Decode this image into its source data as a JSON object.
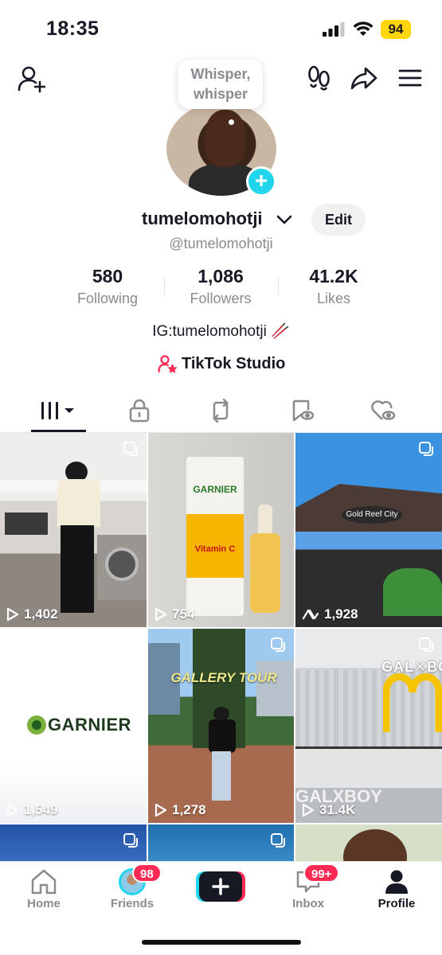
{
  "status_bar": {
    "time": "18:35",
    "battery": "94"
  },
  "profile": {
    "tooltip": "Whisper, whisper",
    "username": "tumelomohotji",
    "handle": "@tumelomohotji",
    "edit_label": "Edit",
    "stats": [
      {
        "value": "580",
        "label": "Following"
      },
      {
        "value": "1,086",
        "label": "Followers"
      },
      {
        "value": "41.2K",
        "label": "Likes"
      }
    ],
    "bio": "IG:tumelomohotji 🥢",
    "studio_label": "TikTok Studio"
  },
  "videos": [
    {
      "views": "1,402",
      "icon": "play"
    },
    {
      "views": "754",
      "icon": "play"
    },
    {
      "views": "1,928",
      "icon": "repost"
    },
    {
      "views": "1,549",
      "icon": "play",
      "brand": "GARNIER"
    },
    {
      "views": "1,278",
      "icon": "play",
      "overlay": "GALLERY TOUR"
    },
    {
      "views": "31.4K",
      "icon": "play",
      "overlay": "GALXBOY"
    }
  ],
  "video_sign_texts": {
    "gold_reef": "Gold Reef City",
    "garnier_bottle": "GARNIER",
    "vitamin": "Vitamin C"
  },
  "bottom_nav": {
    "home": "Home",
    "friends": "Friends",
    "friends_badge": "98",
    "inbox": "Inbox",
    "inbox_badge": "99+",
    "profile": "Profile"
  },
  "colors": {
    "accent": "#fe2c55",
    "cyan": "#20d5ec",
    "battery": "#ffd60a"
  }
}
